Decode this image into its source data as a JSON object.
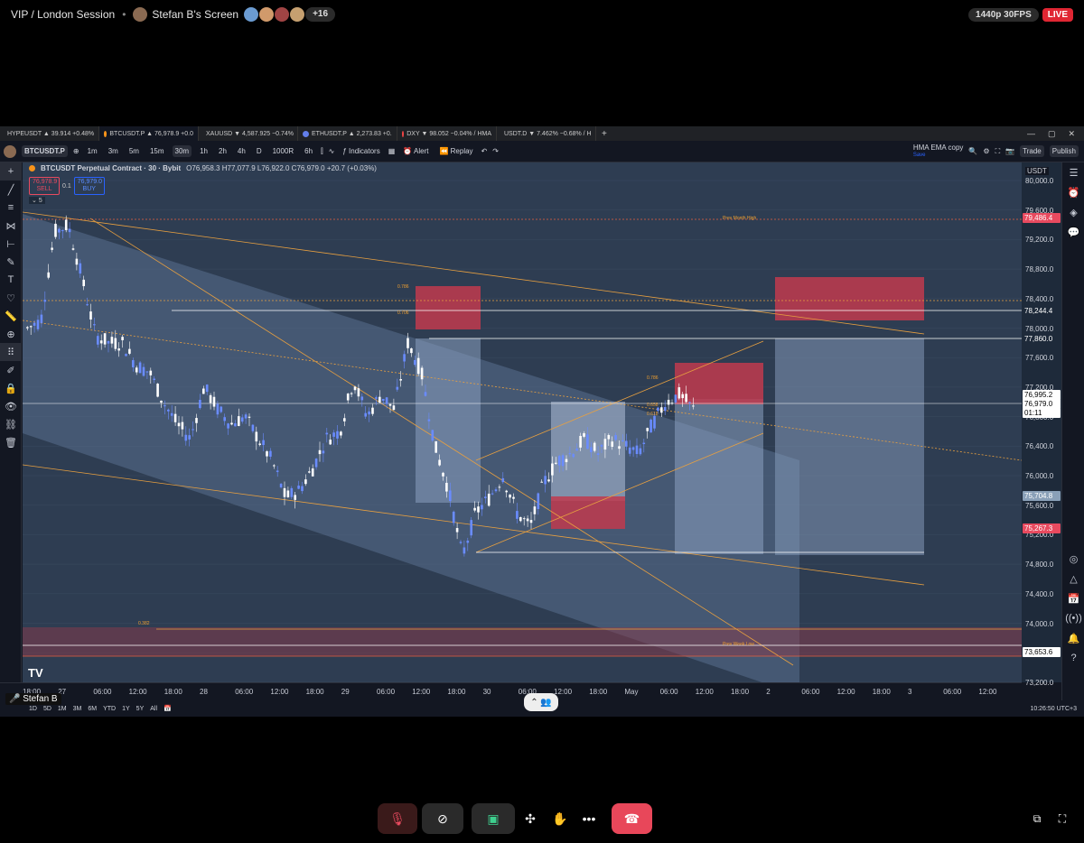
{
  "meeting": {
    "title": "VIP / London Session",
    "presenter_screen": "Stefan B's Screen",
    "extra_participants": "+16",
    "quality_badge": "1440p 30FPS",
    "live_badge": "LIVE",
    "presenter_name": "Stefan B"
  },
  "tabs": [
    {
      "label": "HYPEUSDT ▲ 39.914 +0.48%",
      "color": "#4bd1b6"
    },
    {
      "label": "BTCUSDT.P ▲ 76,978.9 +0.0",
      "color": "#f7931a"
    },
    {
      "label": "XAUUSD ▼ 4,587.925 −0.74%",
      "color": "#d4af37"
    },
    {
      "label": "ETHUSDT.P ▲ 2,273.83 +0.",
      "color": "#627eea"
    },
    {
      "label": "DXY ▼ 98.052 −0.04% / HMA",
      "color": "#e44"
    },
    {
      "label": "USDT.D ▼ 7.462% −0.68% / H",
      "color": "#26a17b"
    }
  ],
  "toolbar": {
    "symbol": "BTCUSDT.P",
    "intervals": [
      "1m",
      "3m",
      "5m",
      "15m",
      "30m",
      "1h",
      "2h",
      "4h",
      "D",
      "1000R",
      "6h"
    ],
    "selected_interval": "30m",
    "indicators": "Indicators",
    "alert": "Alert",
    "replay": "Replay",
    "layout_name": "HMA EMA copy",
    "layout_sub": "Save",
    "trade": "Trade",
    "publish": "Publish"
  },
  "legend": {
    "title": "BTCUSDT Perpetual Contract · 30 · Bybit",
    "ohlc": "O76,958.3 H77,077.9 L76,922.0 C76,979.0 +20.7 (+0.03%)",
    "sell_price": "76,978.9",
    "sell_label": "SELL",
    "spread": "0.1",
    "buy_price": "76,979.0",
    "buy_label": "BUY",
    "indicator_count": "5"
  },
  "price_scale": {
    "currency": "USDT",
    "ticks": [
      "80,000.0",
      "79,600.0",
      "79,200.0",
      "78,800.0",
      "78,400.0",
      "78,000.0",
      "77,600.0",
      "77,200.0",
      "76,800.0",
      "76,400.0",
      "76,000.0",
      "75,600.0",
      "75,200.0",
      "74,800.0",
      "74,400.0",
      "74,000.0",
      "73,600.0",
      "73,200.0"
    ],
    "labels": [
      {
        "text": "79,486.4",
        "bg": "#e84a5f",
        "fg": "#fff"
      },
      {
        "text": "78,244.4",
        "bg": "#1e2a3a",
        "fg": "#fff"
      },
      {
        "text": "77,860.0",
        "bg": "#1e2a3a",
        "fg": "#fff"
      },
      {
        "text": "76,995.2",
        "bg": "#ffffff",
        "fg": "#000"
      },
      {
        "text": "76,979.0",
        "bg": "#ffffff",
        "fg": "#000"
      },
      {
        "text": "01:11",
        "bg": "#ffffff",
        "fg": "#000"
      },
      {
        "text": "75,704.8",
        "bg": "#8aa0b8",
        "fg": "#fff"
      },
      {
        "text": "75,267.3",
        "bg": "#e84a5f",
        "fg": "#fff"
      },
      {
        "text": "73,653.6",
        "bg": "#ffffff",
        "fg": "#000"
      }
    ]
  },
  "time_axis": [
    "18:00",
    "27",
    "06:00",
    "12:00",
    "18:00",
    "28",
    "06:00",
    "12:00",
    "18:00",
    "29",
    "06:00",
    "12:00",
    "18:00",
    "30",
    "06:00",
    "12:00",
    "18:00",
    "May",
    "06:00",
    "12:00",
    "18:00",
    "2",
    "06:00",
    "12:00",
    "18:00",
    "3",
    "06:00",
    "12:00"
  ],
  "annotations": {
    "fib_786_a": "0.786",
    "fib_706": "0.706",
    "fib_786_b": "0.786",
    "fib_658": "0.658",
    "fib_618": "0.618",
    "fib_382": "0.382",
    "prev_month_high": "Prev Month High",
    "prev_week_low": "Prev Week Low"
  },
  "bottom_bar": {
    "ranges": [
      "1D",
      "5D",
      "1M",
      "3M",
      "6M",
      "YTD",
      "1Y",
      "5Y",
      "All"
    ],
    "clock": "10:26:50 UTC+3"
  },
  "chart_data": {
    "type": "candlestick",
    "symbol": "BTCUSDT Perpetual Contract",
    "timeframe": "30",
    "ylim": [
      73200,
      80000
    ],
    "close_path": [
      78000,
      78100,
      79300,
      79400,
      78700,
      77900,
      77800,
      77800,
      77500,
      77400,
      77000,
      76700,
      76500,
      77200,
      76900,
      76700,
      76800,
      76500,
      76200,
      75700,
      75800,
      76100,
      76500,
      76600,
      77300,
      76800,
      77100,
      76900,
      77800,
      77400,
      76400,
      75800,
      74900,
      75500,
      75700,
      76000,
      75500,
      75300,
      75900,
      76200,
      76300,
      76500,
      76300,
      76500,
      76400,
      76300,
      76700,
      77000,
      77100,
      76900
    ]
  },
  "colors": {
    "background": "#131722",
    "pane": "#2e3d52",
    "zone_red": "#c0394d",
    "fib_line": "#e8a040",
    "candle_up": "#ffffff",
    "candle_down": "#6a8cff"
  }
}
